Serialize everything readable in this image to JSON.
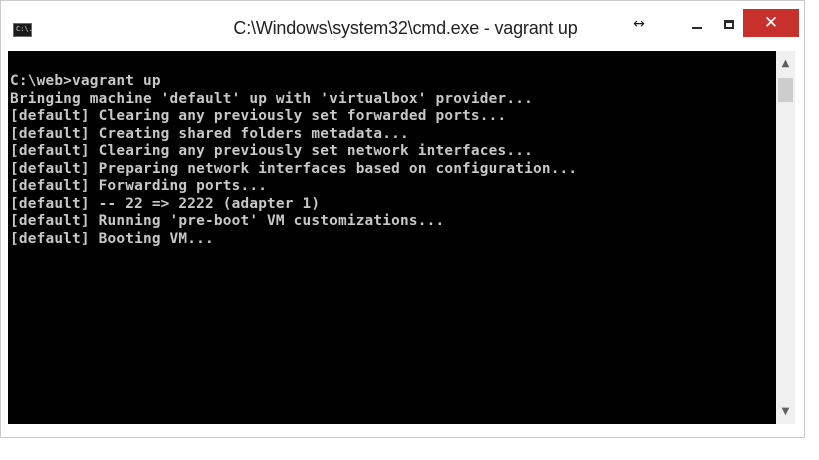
{
  "window": {
    "title": "C:\\Windows\\system32\\cmd.exe - vagrant  up",
    "app_icon": "cmd-icon",
    "app_icon_text": "C:\\.",
    "controls": {
      "resize_icon": "resize-arrows-icon",
      "resize_glyph": "↔",
      "minimize_icon": "minimize-icon",
      "maximize_icon": "maximize-icon",
      "close_icon": "close-icon",
      "close_glyph": "✕",
      "close_color": "#c7302b"
    }
  },
  "console": {
    "background": "#000000",
    "text_color": "#c8c8c8",
    "lines": [
      "C:\\web>vagrant up",
      "Bringing machine 'default' up with 'virtualbox' provider...",
      "[default] Clearing any previously set forwarded ports...",
      "[default] Creating shared folders metadata...",
      "[default] Clearing any previously set network interfaces...",
      "[default] Preparing network interfaces based on configuration...",
      "[default] Forwarding ports...",
      "[default] -- 22 => 2222 (adapter 1)",
      "[default] Running 'pre-boot' VM customizations...",
      "[default] Booting VM..."
    ]
  },
  "scrollbar": {
    "up_icon": "scroll-up-arrow-icon",
    "up_glyph": "▲",
    "down_icon": "scroll-down-arrow-icon",
    "down_glyph": "▼"
  }
}
